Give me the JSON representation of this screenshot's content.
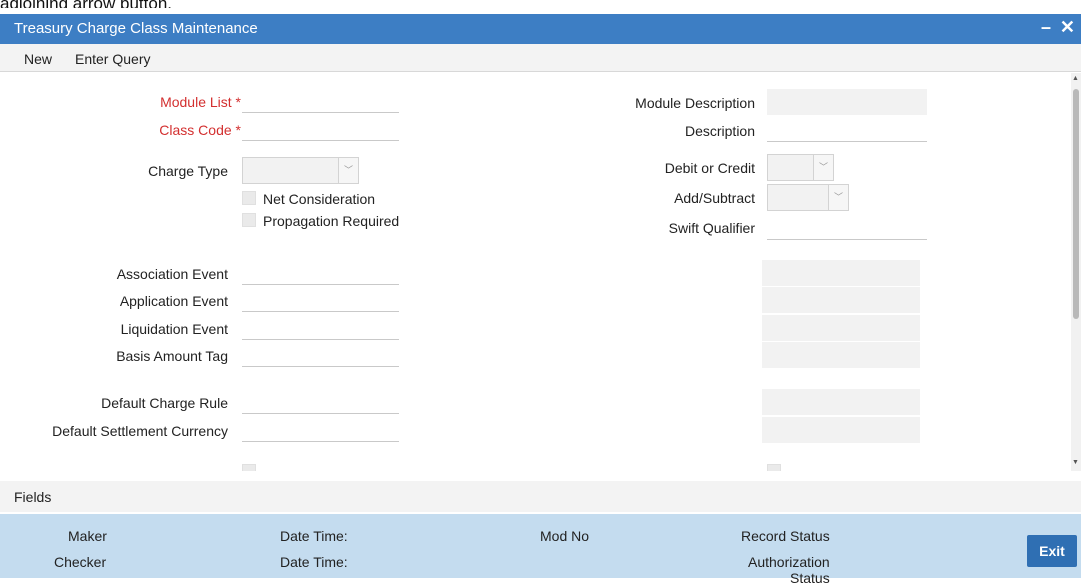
{
  "top_cut_text": "adjoining arrow button.",
  "window": {
    "title": "Treasury Charge Class Maintenance",
    "minimize": "–",
    "close": "✕"
  },
  "toolbar": {
    "new_label": "New",
    "enter_query_label": "Enter Query"
  },
  "form": {
    "module_list_label": "Module List",
    "class_code_label": "Class Code",
    "required_marker": "*",
    "charge_type_label": "Charge Type",
    "net_consideration_label": "Net Consideration",
    "propagation_required_label": "Propagation Required",
    "module_description_label": "Module Description",
    "description_label": "Description",
    "debit_or_credit_label": "Debit or Credit",
    "add_subtract_label": "Add/Subtract",
    "swift_qualifier_label": "Swift Qualifier",
    "association_event_label": "Association Event",
    "application_event_label": "Application Event",
    "liquidation_event_label": "Liquidation Event",
    "basis_amount_tag_label": "Basis Amount Tag",
    "default_charge_rule_label": "Default Charge Rule",
    "default_settlement_currency_label": "Default Settlement Currency",
    "chevron": "﹀"
  },
  "fields_tab": {
    "label": "Fields"
  },
  "audit": {
    "maker_label": "Maker",
    "checker_label": "Checker",
    "date_time_label_1": "Date Time:",
    "date_time_label_2": "Date Time:",
    "mod_no_label": "Mod No",
    "record_status_label": "Record Status",
    "authorization_label": "Authorization",
    "status_label": "Status",
    "exit_label": "Exit"
  },
  "colors": {
    "titlebar": "#3d7ec4",
    "audit_bg": "#c4dcef",
    "exit_button": "#2f6fb3",
    "required": "#d32f2f"
  },
  "icons": {
    "minimize": "minimize-icon",
    "close": "close-icon",
    "dropdown": "chevron-down-icon"
  }
}
